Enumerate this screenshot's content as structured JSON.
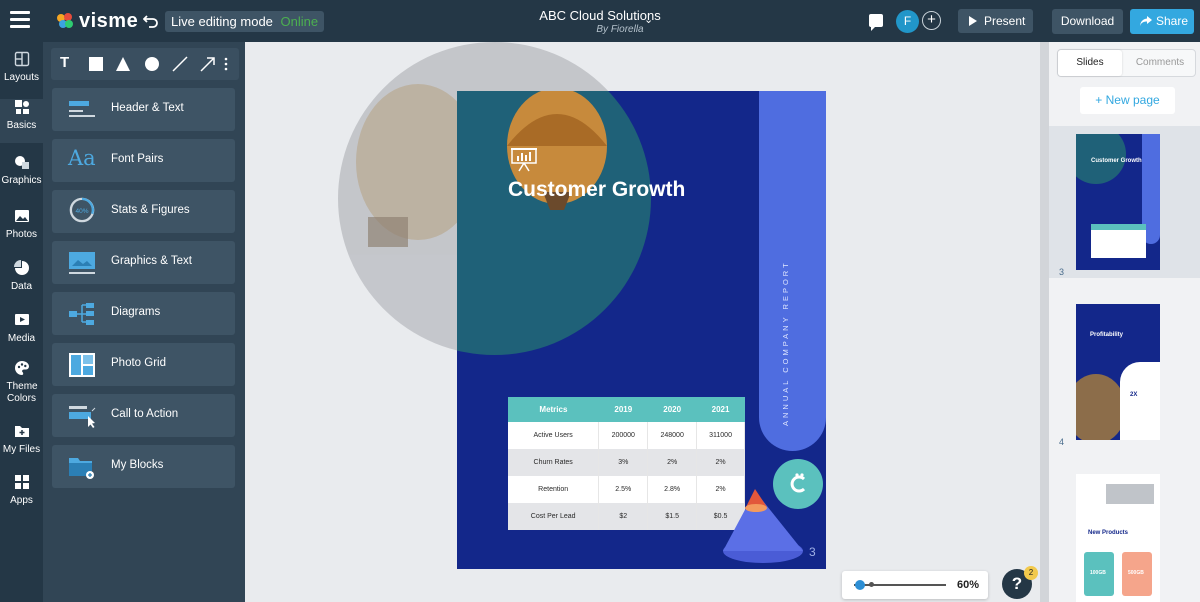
{
  "colors": {
    "topbar": "#243746",
    "accent": "#33a8e0",
    "page_bg": "#13278a",
    "teal": "#5bc1be",
    "stripe": "#4f6de0",
    "online": "#4caf50"
  },
  "header": {
    "app_name": "visme",
    "mode_label": "Live editing mode",
    "mode_status": "Online",
    "doc_title": "ABC Cloud Solutions",
    "doc_author": "By Fiorella",
    "avatar_initial": "F",
    "present_label": "Present",
    "download_label": "Download",
    "share_label": "Share"
  },
  "rail": {
    "items": [
      {
        "label": "Layouts",
        "icon": "layouts-icon"
      },
      {
        "label": "Basics",
        "icon": "basics-icon"
      },
      {
        "label": "Graphics",
        "icon": "graphics-icon"
      },
      {
        "label": "Photos",
        "icon": "photos-icon"
      },
      {
        "label": "Data",
        "icon": "data-icon"
      },
      {
        "label": "Media",
        "icon": "media-icon"
      },
      {
        "label": "Theme Colors",
        "icon": "theme-colors-icon"
      },
      {
        "label": "My Files",
        "icon": "my-files-icon"
      },
      {
        "label": "Apps",
        "icon": "apps-icon"
      }
    ]
  },
  "panel": {
    "tools": [
      "text-tool-icon",
      "rectangle-tool-icon",
      "triangle-tool-icon",
      "circle-tool-icon",
      "line-tool-icon",
      "arrow-tool-icon",
      "more-icon"
    ],
    "text_tool": "T",
    "items": [
      {
        "label": "Header & Text"
      },
      {
        "label": "Font Pairs"
      },
      {
        "label": "Stats & Figures"
      },
      {
        "label": "Graphics & Text"
      },
      {
        "label": "Diagrams"
      },
      {
        "label": "Photo Grid"
      },
      {
        "label": "Call to Action"
      },
      {
        "label": "My Blocks"
      }
    ],
    "stats_icon_text": "40%",
    "font_pairs_glyph": "Aa"
  },
  "slide": {
    "title": "Customer Growth",
    "vertical_text": "ANNUAL COMPANY REPORT",
    "page_number": "3",
    "table": {
      "headers": [
        "Metrics",
        "2019",
        "2020",
        "2021"
      ],
      "rows": [
        [
          "Active Users",
          "200000",
          "248000",
          "311000"
        ],
        [
          "Churn Rates",
          "3%",
          "2%",
          "2%"
        ],
        [
          "Retention",
          "2.5%",
          "2.8%",
          "2%"
        ],
        [
          "Cost Per Lead",
          "$2",
          "$1.5",
          "$0.5"
        ]
      ]
    }
  },
  "zoom": {
    "value": "60%",
    "level": 0.06
  },
  "help": {
    "label": "?",
    "badge": "2"
  },
  "right_panel": {
    "tabs": [
      "Slides",
      "Comments"
    ],
    "new_page_label": "+ New page",
    "thumbnails": [
      {
        "number": "3",
        "title": "Customer Growth"
      },
      {
        "number": "4",
        "title": "Profitability",
        "stat": "2X"
      },
      {
        "number": "",
        "title": "New Products",
        "stat_a": "100GB",
        "stat_b": "500GB"
      }
    ]
  }
}
